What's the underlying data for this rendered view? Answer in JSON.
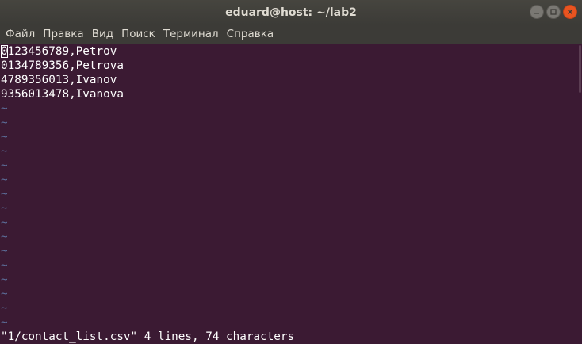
{
  "window": {
    "title": "eduard@host: ~/lab2"
  },
  "menu": [
    "Файл",
    "Правка",
    "Вид",
    "Поиск",
    "Терминал",
    "Справка"
  ],
  "editor": {
    "lines": [
      "0123456789,Petrov",
      "0134789356,Petrova",
      "4789356013,Ivanov",
      "9356013478,Ivanova"
    ],
    "empty_line_marker": "~",
    "empty_line_count": 16,
    "status": "\"1/contact_list.csv\" 4 lines, 74 characters"
  },
  "colors": {
    "terminal_bg": "#3b1a33",
    "titlebar_bg": "#3c3b37",
    "tilde": "#5c6f9a",
    "close_button": "#e95420"
  },
  "icons": {
    "minimize": "minimize-icon",
    "maximize": "maximize-icon",
    "close": "close-icon"
  }
}
